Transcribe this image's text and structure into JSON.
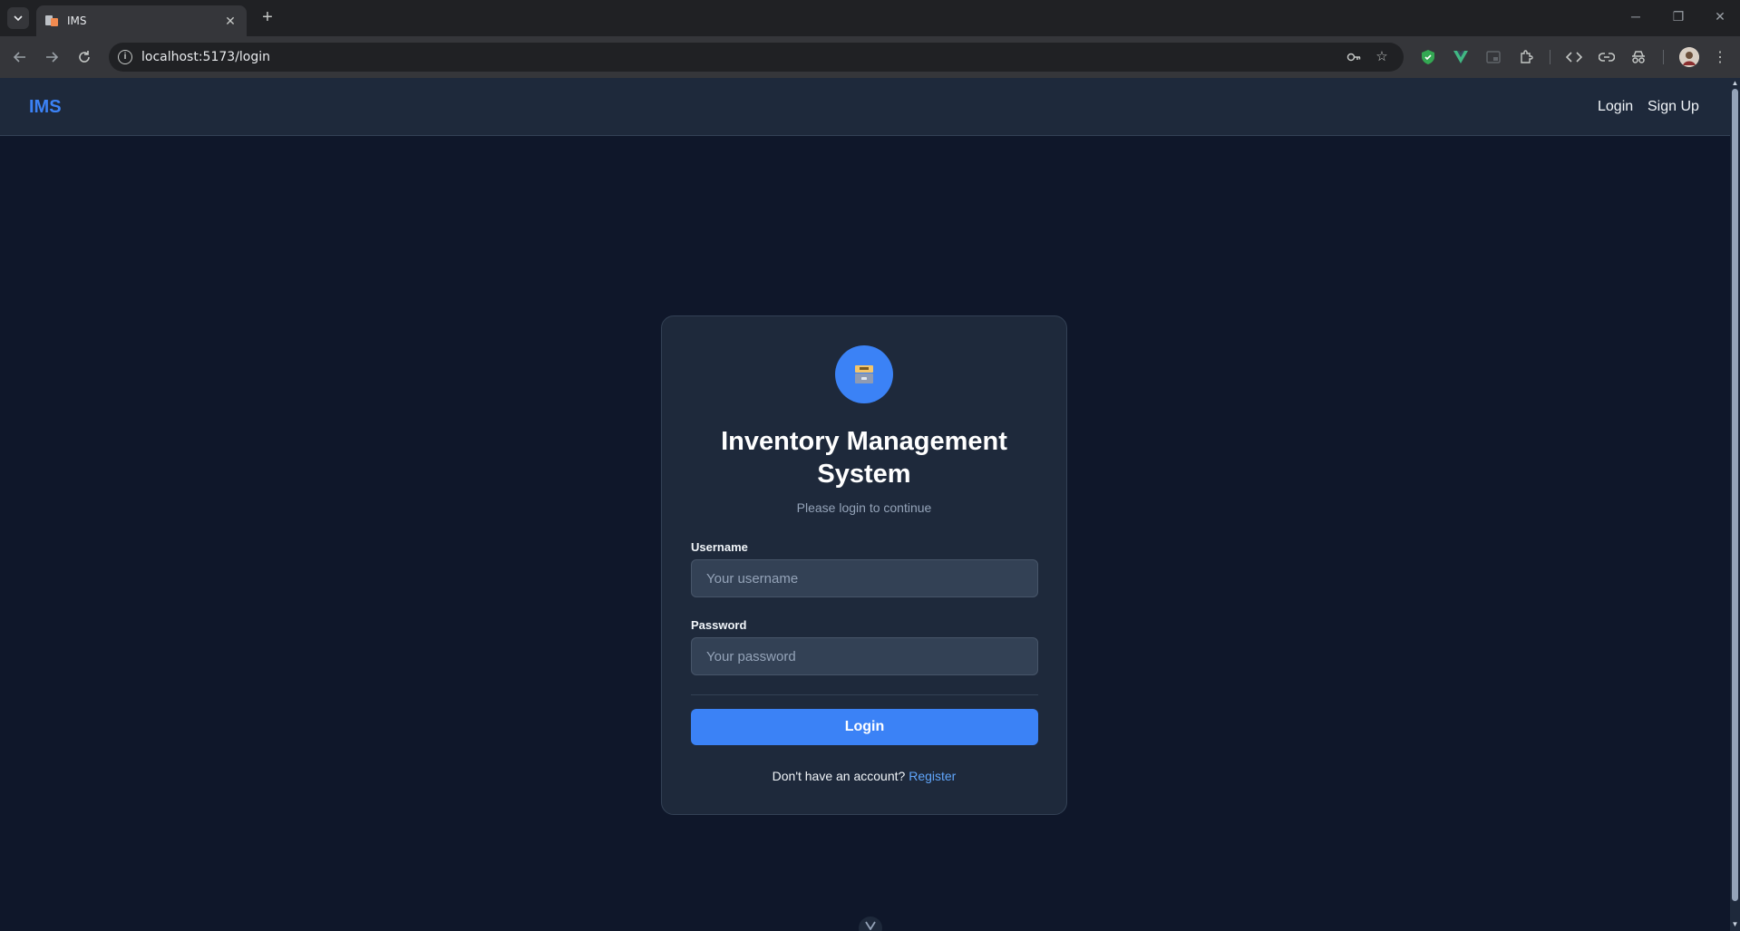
{
  "browser": {
    "tab_title": "IMS",
    "tab_close": "✕",
    "new_tab": "+",
    "url": "localhost:5173/login",
    "icons": [
      "tab-search-icon",
      "back-icon",
      "forward-icon",
      "reload-icon",
      "site-info-icon",
      "key-icon",
      "star-icon",
      "shield-extension-icon",
      "vue-extension-icon",
      "picture-in-picture-icon",
      "extensions-icon",
      "code-icon",
      "link-icon",
      "incognito-icon",
      "profile-avatar-icon",
      "more-icon"
    ]
  },
  "navbar": {
    "brand": "IMS",
    "links": [
      "Login",
      "Sign Up"
    ]
  },
  "login_card": {
    "title": "Inventory Management System",
    "subtitle": "Please login to continue",
    "username_label": "Username",
    "username_placeholder": "Your username",
    "password_label": "Password",
    "password_placeholder": "Your password",
    "submit_label": "Login",
    "footer_text": "Don't have an account?",
    "register_link": "Register",
    "logo_icon": "file-cabinet-icon"
  },
  "colors": {
    "page_bg": "#0f172a",
    "card_bg": "#1e293b",
    "accent": "#3b82f6",
    "link": "#60a5fa"
  }
}
